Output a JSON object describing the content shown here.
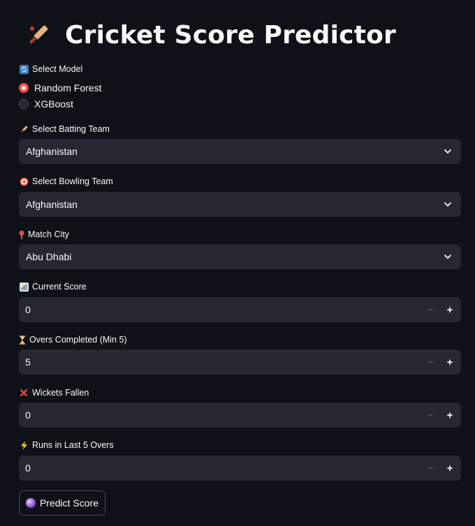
{
  "title": {
    "text": "Cricket Score Predictor",
    "icon": "cricket-bat-icon"
  },
  "model": {
    "label": "Select Model",
    "icon": "refresh-icon",
    "options": [
      {
        "label": "Random Forest",
        "selected": true
      },
      {
        "label": "XGBoost",
        "selected": false
      }
    ]
  },
  "batting_team": {
    "label": "Select Batting Team",
    "icon": "cricket-bat-icon",
    "value": "Afghanistan"
  },
  "bowling_team": {
    "label": "Select Bowling Team",
    "icon": "target-icon",
    "value": "Afghanistan"
  },
  "city": {
    "label": "Match City",
    "icon": "pin-icon",
    "value": "Abu Dhabi"
  },
  "current_score": {
    "label": "Current Score",
    "icon": "chart-icon",
    "value": "0"
  },
  "overs": {
    "label": "Overs Completed (Min 5)",
    "icon": "hourglass-icon",
    "value": "5"
  },
  "wickets": {
    "label": "Wickets Fallen",
    "icon": "cross-icon",
    "value": "0"
  },
  "runs_last5": {
    "label": "Runs in Last 5 Overs",
    "icon": "lightning-icon",
    "value": "0"
  },
  "predict_button": {
    "label": "Predict Score",
    "icon": "crystal-ball-icon"
  },
  "colors": {
    "background": "#0e1117",
    "input": "#262730",
    "accent": "#ff4b4b",
    "text": "#fafafa"
  }
}
